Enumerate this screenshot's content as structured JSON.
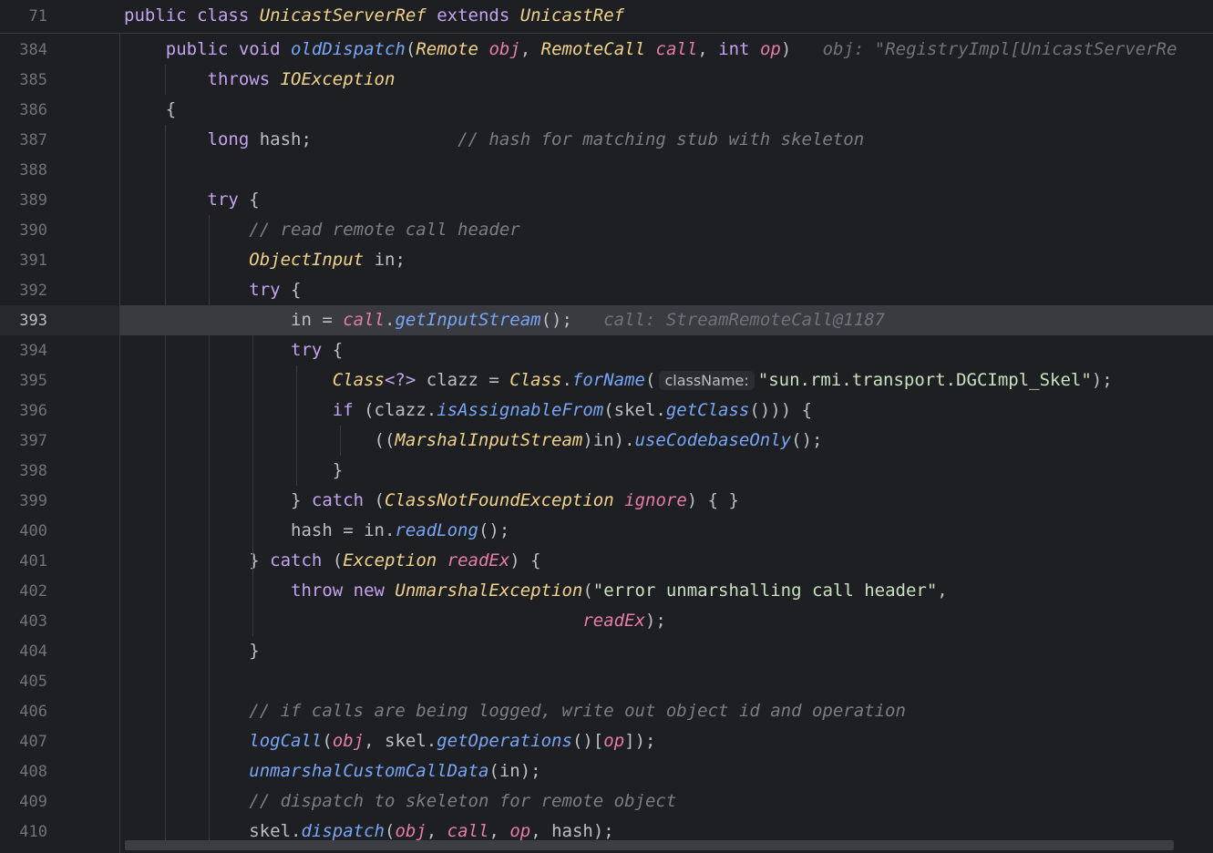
{
  "sticky": {
    "line_number": "71",
    "tokens": [
      {
        "c": "k",
        "t": "public class "
      },
      {
        "c": "t",
        "t": "UnicastServerRef"
      },
      {
        "c": "k",
        "t": " extends "
      },
      {
        "c": "t",
        "t": "UnicastRef"
      }
    ]
  },
  "current_line": "393",
  "lines": [
    {
      "n": "384",
      "tokens": [
        {
          "c": "",
          "t": "    "
        },
        {
          "c": "k",
          "t": "public void "
        },
        {
          "c": "m",
          "t": "oldDispatch"
        },
        {
          "c": "",
          "t": "("
        },
        {
          "c": "t",
          "t": "Remote"
        },
        {
          "c": "",
          "t": " "
        },
        {
          "c": "v",
          "t": "obj"
        },
        {
          "c": "",
          "t": ", "
        },
        {
          "c": "t",
          "t": "RemoteCall"
        },
        {
          "c": "",
          "t": " "
        },
        {
          "c": "v",
          "t": "call"
        },
        {
          "c": "",
          "t": ", "
        },
        {
          "c": "k",
          "t": "int"
        },
        {
          "c": "",
          "t": " "
        },
        {
          "c": "v",
          "t": "op"
        },
        {
          "c": "",
          "t": ")"
        },
        {
          "c": "hint",
          "t": "   obj: \"RegistryImpl[UnicastServerRe"
        }
      ]
    },
    {
      "n": "385",
      "tokens": [
        {
          "c": "",
          "t": "        "
        },
        {
          "c": "k",
          "t": "throws "
        },
        {
          "c": "t",
          "t": "IOException"
        }
      ]
    },
    {
      "n": "386",
      "tokens": [
        {
          "c": "",
          "t": "    {"
        }
      ]
    },
    {
      "n": "387",
      "tokens": [
        {
          "c": "",
          "t": "        "
        },
        {
          "c": "k",
          "t": "long"
        },
        {
          "c": "",
          "t": " hash;"
        },
        {
          "c": "cm",
          "t": "              // hash for matching stub with skeleton"
        }
      ]
    },
    {
      "n": "388",
      "tokens": [
        {
          "c": "",
          "t": ""
        }
      ]
    },
    {
      "n": "389",
      "tokens": [
        {
          "c": "",
          "t": "        "
        },
        {
          "c": "k",
          "t": "try"
        },
        {
          "c": "",
          "t": " {"
        }
      ]
    },
    {
      "n": "390",
      "tokens": [
        {
          "c": "",
          "t": "            "
        },
        {
          "c": "cm",
          "t": "// read remote call header"
        }
      ]
    },
    {
      "n": "391",
      "tokens": [
        {
          "c": "",
          "t": "            "
        },
        {
          "c": "t",
          "t": "ObjectInput"
        },
        {
          "c": "",
          "t": " in;"
        }
      ]
    },
    {
      "n": "392",
      "tokens": [
        {
          "c": "",
          "t": "            "
        },
        {
          "c": "k",
          "t": "try"
        },
        {
          "c": "",
          "t": " {"
        }
      ]
    },
    {
      "n": "393",
      "tokens": [
        {
          "c": "",
          "t": "                in = "
        },
        {
          "c": "v",
          "t": "call"
        },
        {
          "c": "",
          "t": "."
        },
        {
          "c": "m",
          "t": "getInputStream"
        },
        {
          "c": "",
          "t": "();"
        },
        {
          "c": "hint",
          "t": "   call: StreamRemoteCall@1187"
        }
      ]
    },
    {
      "n": "394",
      "tokens": [
        {
          "c": "",
          "t": "                "
        },
        {
          "c": "k",
          "t": "try"
        },
        {
          "c": "",
          "t": " {"
        }
      ]
    },
    {
      "n": "395",
      "tokens": [
        {
          "c": "",
          "t": "                    "
        },
        {
          "c": "t",
          "t": "Class"
        },
        {
          "c": "k",
          "t": "<?>"
        },
        {
          "c": "",
          "t": " clazz = "
        },
        {
          "c": "t",
          "t": "Class"
        },
        {
          "c": "",
          "t": "."
        },
        {
          "c": "m",
          "t": "forName"
        },
        {
          "c": "",
          "t": "("
        },
        {
          "c": "inlay",
          "t": "className:"
        },
        {
          "c": "s",
          "t": "\"sun.rmi.transport.DGCImpl_Skel\""
        },
        {
          "c": "",
          "t": ");"
        }
      ]
    },
    {
      "n": "396",
      "tokens": [
        {
          "c": "",
          "t": "                    "
        },
        {
          "c": "k",
          "t": "if"
        },
        {
          "c": "",
          "t": " (clazz."
        },
        {
          "c": "m",
          "t": "isAssignableFrom"
        },
        {
          "c": "",
          "t": "(skel."
        },
        {
          "c": "m",
          "t": "getClass"
        },
        {
          "c": "",
          "t": "())) {"
        }
      ]
    },
    {
      "n": "397",
      "tokens": [
        {
          "c": "",
          "t": "                        (("
        },
        {
          "c": "t",
          "t": "MarshalInputStream"
        },
        {
          "c": "",
          "t": ")in)."
        },
        {
          "c": "m",
          "t": "useCodebaseOnly"
        },
        {
          "c": "",
          "t": "();"
        }
      ]
    },
    {
      "n": "398",
      "tokens": [
        {
          "c": "",
          "t": "                    }"
        }
      ]
    },
    {
      "n": "399",
      "tokens": [
        {
          "c": "",
          "t": "                } "
        },
        {
          "c": "k",
          "t": "catch"
        },
        {
          "c": "",
          "t": " ("
        },
        {
          "c": "t",
          "t": "ClassNotFoundException"
        },
        {
          "c": "",
          "t": " "
        },
        {
          "c": "v",
          "t": "ignore"
        },
        {
          "c": "",
          "t": ") { }"
        }
      ]
    },
    {
      "n": "400",
      "tokens": [
        {
          "c": "",
          "t": "                hash = in."
        },
        {
          "c": "m",
          "t": "readLong"
        },
        {
          "c": "",
          "t": "();"
        }
      ]
    },
    {
      "n": "401",
      "tokens": [
        {
          "c": "",
          "t": "            } "
        },
        {
          "c": "k",
          "t": "catch"
        },
        {
          "c": "",
          "t": " ("
        },
        {
          "c": "t",
          "t": "Exception"
        },
        {
          "c": "",
          "t": " "
        },
        {
          "c": "v",
          "t": "readEx"
        },
        {
          "c": "",
          "t": ") {"
        }
      ]
    },
    {
      "n": "402",
      "tokens": [
        {
          "c": "",
          "t": "                "
        },
        {
          "c": "k",
          "t": "throw new "
        },
        {
          "c": "t",
          "t": "UnmarshalException"
        },
        {
          "c": "",
          "t": "("
        },
        {
          "c": "s",
          "t": "\"error unmarshalling call header\""
        },
        {
          "c": "",
          "t": ","
        }
      ]
    },
    {
      "n": "403",
      "tokens": [
        {
          "c": "",
          "t": "                                            "
        },
        {
          "c": "v",
          "t": "readEx"
        },
        {
          "c": "",
          "t": ");"
        }
      ]
    },
    {
      "n": "404",
      "tokens": [
        {
          "c": "",
          "t": "            }"
        }
      ]
    },
    {
      "n": "405",
      "tokens": [
        {
          "c": "",
          "t": ""
        }
      ]
    },
    {
      "n": "406",
      "tokens": [
        {
          "c": "",
          "t": "            "
        },
        {
          "c": "cm",
          "t": "// if calls are being logged, write out object id and operation"
        }
      ]
    },
    {
      "n": "407",
      "tokens": [
        {
          "c": "",
          "t": "            "
        },
        {
          "c": "m",
          "t": "logCall"
        },
        {
          "c": "",
          "t": "("
        },
        {
          "c": "v",
          "t": "obj"
        },
        {
          "c": "",
          "t": ", skel."
        },
        {
          "c": "m",
          "t": "getOperations"
        },
        {
          "c": "",
          "t": "()["
        },
        {
          "c": "v",
          "t": "op"
        },
        {
          "c": "",
          "t": "]);"
        }
      ]
    },
    {
      "n": "408",
      "tokens": [
        {
          "c": "",
          "t": "            "
        },
        {
          "c": "m",
          "t": "unmarshalCustomCallData"
        },
        {
          "c": "",
          "t": "(in);"
        }
      ]
    },
    {
      "n": "409",
      "tokens": [
        {
          "c": "",
          "t": "            "
        },
        {
          "c": "cm",
          "t": "// dispatch to skeleton for remote object"
        }
      ]
    },
    {
      "n": "410",
      "tokens": [
        {
          "c": "",
          "t": "            skel."
        },
        {
          "c": "m",
          "t": "dispatch"
        },
        {
          "c": "",
          "t": "("
        },
        {
          "c": "v",
          "t": "obj"
        },
        {
          "c": "",
          "t": ", "
        },
        {
          "c": "v",
          "t": "call"
        },
        {
          "c": "",
          "t": ", "
        },
        {
          "c": "v",
          "t": "op"
        },
        {
          "c": "",
          "t": ", hash);"
        }
      ]
    }
  ]
}
